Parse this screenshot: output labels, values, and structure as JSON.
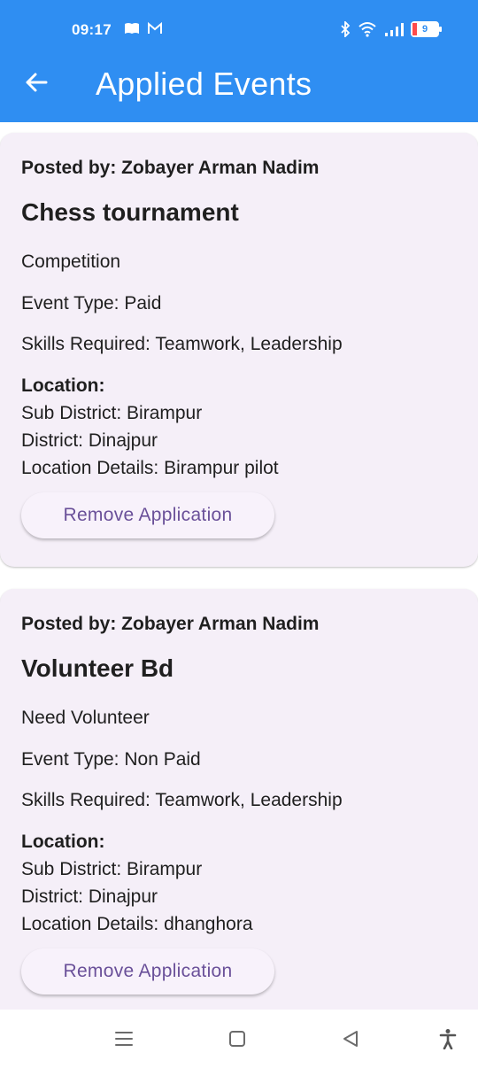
{
  "status_bar": {
    "time": "09:17",
    "battery_level": "9",
    "icons": [
      "book-icon",
      "gmail-icon",
      "bluetooth-icon",
      "wifi-icon",
      "signal-icon",
      "battery-icon"
    ]
  },
  "app_bar": {
    "title": "Applied Events",
    "color": "#2f8ef2",
    "back_icon": "arrow-left-icon"
  },
  "events": [
    {
      "posted_by": "Posted by: Zobayer Arman Nadim",
      "title": "Chess tournament",
      "description": "Competition",
      "event_type": "Event Type: Paid",
      "skills": "Skills Required: Teamwork, Leadership",
      "location_label": "Location:",
      "sub_district": "Sub District: Birampur",
      "district": "District: Dinajpur",
      "location_details": "Location Details: Birampur pilot",
      "action_label": "Remove Application"
    },
    {
      "posted_by": "Posted by: Zobayer Arman Nadim",
      "title": "Volunteer Bd",
      "description": "Need Volunteer",
      "event_type": "Event Type: Non Paid",
      "skills": "Skills Required: Teamwork, Leadership",
      "location_label": "Location:",
      "sub_district": "Sub District: Birampur",
      "district": "District: Dinajpur",
      "location_details": "Location Details: dhanghora",
      "action_label": "Remove Application"
    }
  ],
  "nav_bar": {
    "items": [
      "menu-icon",
      "home-square-icon",
      "back-triangle-icon",
      "accessibility-icon"
    ]
  }
}
